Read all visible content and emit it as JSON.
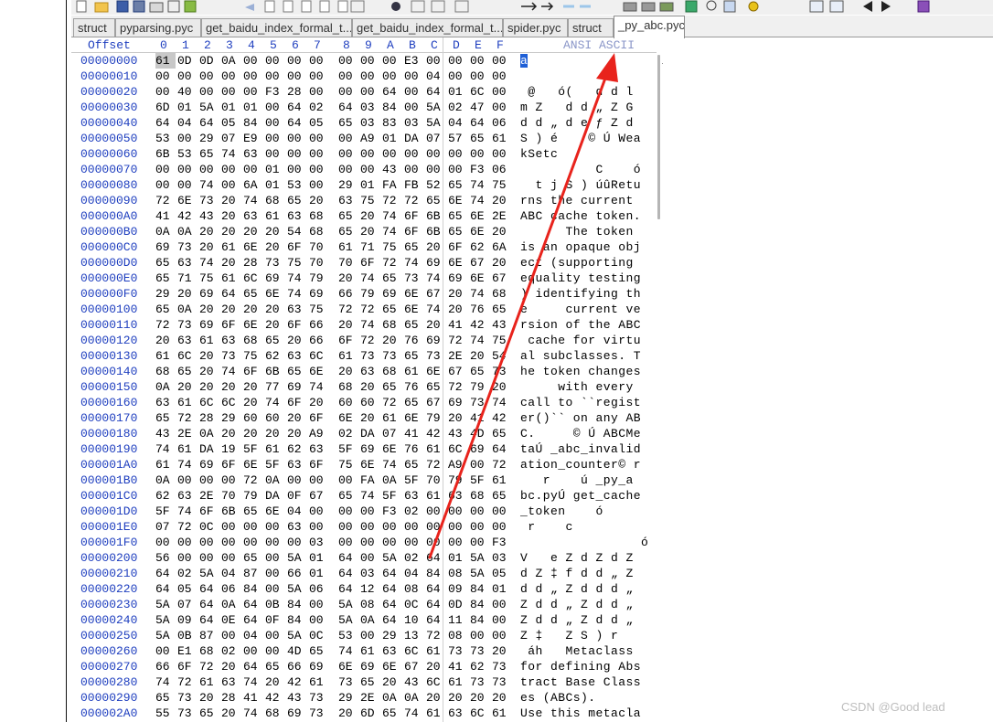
{
  "tabs": [
    {
      "label": "struct",
      "active": false
    },
    {
      "label": "pyparsing.pyc",
      "active": false
    },
    {
      "label": "get_baidu_index_formal_t...",
      "active": false
    },
    {
      "label": "get_baidu_index_formal_t...",
      "active": false
    },
    {
      "label": "spider.pyc",
      "active": false
    },
    {
      "label": "struct",
      "active": false
    },
    {
      "label": "_py_abc.pyc",
      "active": true
    }
  ],
  "header": {
    "offset_label": "Offset",
    "columns": [
      "0",
      "1",
      "2",
      "3",
      "4",
      "5",
      "6",
      "7",
      "8",
      "9",
      "A",
      "B",
      "C",
      "D",
      "E",
      "F"
    ],
    "ascii_label": "ANSI ASCII"
  },
  "rows": [
    {
      "offset": "00000000",
      "bytes": [
        "61",
        "0D",
        "0D",
        "0A",
        "00",
        "00",
        "00",
        "00",
        "00",
        "00",
        "00",
        "E3",
        "00",
        "00",
        "00",
        "00"
      ],
      "ascii": "a                 ã"
    },
    {
      "offset": "00000010",
      "bytes": [
        "00",
        "00",
        "00",
        "00",
        "00",
        "00",
        "00",
        "00",
        "00",
        "00",
        "00",
        "00",
        "04",
        "00",
        "00",
        "00"
      ],
      "ascii": ""
    },
    {
      "offset": "00000020",
      "bytes": [
        "00",
        "40",
        "00",
        "00",
        "00",
        "F3",
        "28",
        "00",
        "00",
        "00",
        "64",
        "00",
        "64",
        "01",
        "6C",
        "00"
      ],
      "ascii": " @   ó(   d d l"
    },
    {
      "offset": "00000030",
      "bytes": [
        "6D",
        "01",
        "5A",
        "01",
        "01",
        "00",
        "64",
        "02",
        "64",
        "03",
        "84",
        "00",
        "5A",
        "02",
        "47",
        "00"
      ],
      "ascii": "m Z   d d „ Z G"
    },
    {
      "offset": "00000040",
      "bytes": [
        "64",
        "04",
        "64",
        "05",
        "84",
        "00",
        "64",
        "05",
        "65",
        "03",
        "83",
        "03",
        "5A",
        "04",
        "64",
        "06"
      ],
      "ascii": "d d „ d e ƒ Z d"
    },
    {
      "offset": "00000050",
      "bytes": [
        "53",
        "00",
        "29",
        "07",
        "E9",
        "00",
        "00",
        "00",
        "00",
        "A9",
        "01",
        "DA",
        "07",
        "57",
        "65",
        "61"
      ],
      "ascii": "S ) é    © Ú Wea"
    },
    {
      "offset": "00000060",
      "bytes": [
        "6B",
        "53",
        "65",
        "74",
        "63",
        "00",
        "00",
        "00",
        "00",
        "00",
        "00",
        "00",
        "00",
        "00",
        "00",
        "00"
      ],
      "ascii": "kSetc"
    },
    {
      "offset": "00000070",
      "bytes": [
        "00",
        "00",
        "00",
        "00",
        "00",
        "01",
        "00",
        "00",
        "00",
        "00",
        "43",
        "00",
        "00",
        "00",
        "F3",
        "06",
        "00"
      ],
      "ascii": "          C    ó"
    },
    {
      "offset": "00000080",
      "bytes": [
        "00",
        "00",
        "74",
        "00",
        "6A",
        "01",
        "53",
        "00",
        "29",
        "01",
        "FA",
        "FB",
        "52",
        "65",
        "74",
        "75"
      ],
      "ascii": "  t j S ) úûRetu"
    },
    {
      "offset": "00000090",
      "bytes": [
        "72",
        "6E",
        "73",
        "20",
        "74",
        "68",
        "65",
        "20",
        "63",
        "75",
        "72",
        "72",
        "65",
        "6E",
        "74",
        "20"
      ],
      "ascii": "rns the current "
    },
    {
      "offset": "000000A0",
      "bytes": [
        "41",
        "42",
        "43",
        "20",
        "63",
        "61",
        "63",
        "68",
        "65",
        "20",
        "74",
        "6F",
        "6B",
        "65",
        "6E",
        "2E"
      ],
      "ascii": "ABC cache token."
    },
    {
      "offset": "000000B0",
      "bytes": [
        "0A",
        "0A",
        "20",
        "20",
        "20",
        "20",
        "54",
        "68",
        "65",
        "20",
        "74",
        "6F",
        "6B",
        "65",
        "6E",
        "20"
      ],
      "ascii": "      The token "
    },
    {
      "offset": "000000C0",
      "bytes": [
        "69",
        "73",
        "20",
        "61",
        "6E",
        "20",
        "6F",
        "70",
        "61",
        "71",
        "75",
        "65",
        "20",
        "6F",
        "62",
        "6A"
      ],
      "ascii": "is an opaque obj"
    },
    {
      "offset": "000000D0",
      "bytes": [
        "65",
        "63",
        "74",
        "20",
        "28",
        "73",
        "75",
        "70",
        "70",
        "6F",
        "72",
        "74",
        "69",
        "6E",
        "67",
        "20"
      ],
      "ascii": "ect (supporting "
    },
    {
      "offset": "000000E0",
      "bytes": [
        "65",
        "71",
        "75",
        "61",
        "6C",
        "69",
        "74",
        "79",
        "20",
        "74",
        "65",
        "73",
        "74",
        "69",
        "6E",
        "67"
      ],
      "ascii": "equality testing"
    },
    {
      "offset": "000000F0",
      "bytes": [
        "29",
        "20",
        "69",
        "64",
        "65",
        "6E",
        "74",
        "69",
        "66",
        "79",
        "69",
        "6E",
        "67",
        "20",
        "74",
        "68"
      ],
      "ascii": ") identifying th"
    },
    {
      "offset": "00000100",
      "bytes": [
        "65",
        "0A",
        "20",
        "20",
        "20",
        "20",
        "63",
        "75",
        "72",
        "72",
        "65",
        "6E",
        "74",
        "20",
        "76",
        "65"
      ],
      "ascii": "e     current ve"
    },
    {
      "offset": "00000110",
      "bytes": [
        "72",
        "73",
        "69",
        "6F",
        "6E",
        "20",
        "6F",
        "66",
        "20",
        "74",
        "68",
        "65",
        "20",
        "41",
        "42",
        "43"
      ],
      "ascii": "rsion of the ABC"
    },
    {
      "offset": "00000120",
      "bytes": [
        "20",
        "63",
        "61",
        "63",
        "68",
        "65",
        "20",
        "66",
        "6F",
        "72",
        "20",
        "76",
        "69",
        "72",
        "74",
        "75"
      ],
      "ascii": " cache for virtu"
    },
    {
      "offset": "00000130",
      "bytes": [
        "61",
        "6C",
        "20",
        "73",
        "75",
        "62",
        "63",
        "6C",
        "61",
        "73",
        "73",
        "65",
        "73",
        "2E",
        "20",
        "54"
      ],
      "ascii": "al subclasses. T"
    },
    {
      "offset": "00000140",
      "bytes": [
        "68",
        "65",
        "20",
        "74",
        "6F",
        "6B",
        "65",
        "6E",
        "20",
        "63",
        "68",
        "61",
        "6E",
        "67",
        "65",
        "73"
      ],
      "ascii": "he token changes"
    },
    {
      "offset": "00000150",
      "bytes": [
        "0A",
        "20",
        "20",
        "20",
        "20",
        "77",
        "69",
        "74",
        "68",
        "20",
        "65",
        "76",
        "65",
        "72",
        "79",
        "20"
      ],
      "ascii": "     with every "
    },
    {
      "offset": "00000160",
      "bytes": [
        "63",
        "61",
        "6C",
        "6C",
        "20",
        "74",
        "6F",
        "20",
        "60",
        "60",
        "72",
        "65",
        "67",
        "69",
        "73",
        "74"
      ],
      "ascii": "call to ``regist"
    },
    {
      "offset": "00000170",
      "bytes": [
        "65",
        "72",
        "28",
        "29",
        "60",
        "60",
        "20",
        "6F",
        "6E",
        "20",
        "61",
        "6E",
        "79",
        "20",
        "41",
        "42"
      ],
      "ascii": "er()`` on any AB"
    },
    {
      "offset": "00000180",
      "bytes": [
        "43",
        "2E",
        "0A",
        "20",
        "20",
        "20",
        "20",
        "A9",
        "02",
        "DA",
        "07",
        "41",
        "42",
        "43",
        "4D",
        "65"
      ],
      "ascii": "C.     © Ú ABCMe"
    },
    {
      "offset": "00000190",
      "bytes": [
        "74",
        "61",
        "DA",
        "19",
        "5F",
        "61",
        "62",
        "63",
        "5F",
        "69",
        "6E",
        "76",
        "61",
        "6C",
        "69",
        "64"
      ],
      "ascii": "taÚ _abc_invalid"
    },
    {
      "offset": "000001A0",
      "bytes": [
        "61",
        "74",
        "69",
        "6F",
        "6E",
        "5F",
        "63",
        "6F",
        "75",
        "6E",
        "74",
        "65",
        "72",
        "A9",
        "00",
        "72"
      ],
      "ascii": "ation_counter© r"
    },
    {
      "offset": "000001B0",
      "bytes": [
        "0A",
        "00",
        "00",
        "00",
        "72",
        "0A",
        "00",
        "00",
        "00",
        "FA",
        "0A",
        "5F",
        "70",
        "79",
        "5F",
        "61"
      ],
      "ascii": "   r    ú _py_a"
    },
    {
      "offset": "000001C0",
      "bytes": [
        "62",
        "63",
        "2E",
        "70",
        "79",
        "DA",
        "0F",
        "67",
        "65",
        "74",
        "5F",
        "63",
        "61",
        "63",
        "68",
        "65"
      ],
      "ascii": "bc.pyÚ get_cache"
    },
    {
      "offset": "000001D0",
      "bytes": [
        "5F",
        "74",
        "6F",
        "6B",
        "65",
        "6E",
        "04",
        "00",
        "00",
        "00",
        "F3",
        "02",
        "00",
        "00",
        "00",
        "00"
      ],
      "ascii": "_token    ó"
    },
    {
      "offset": "000001E0",
      "bytes": [
        "07",
        "72",
        "0C",
        "00",
        "00",
        "00",
        "63",
        "00",
        "00",
        "00",
        "00",
        "00",
        "00",
        "00",
        "00",
        "00"
      ],
      "ascii": " r    c"
    },
    {
      "offset": "000001F0",
      "bytes": [
        "00",
        "00",
        "00",
        "00",
        "00",
        "00",
        "00",
        "03",
        "00",
        "00",
        "00",
        "00",
        "00",
        "00",
        "00",
        "F3"
      ],
      "ascii": "                ó"
    },
    {
      "offset": "00000200",
      "bytes": [
        "56",
        "00",
        "00",
        "00",
        "65",
        "00",
        "5A",
        "01",
        "64",
        "00",
        "5A",
        "02",
        "64",
        "01",
        "5A",
        "03"
      ],
      "ascii": "V   e Z d Z d Z"
    },
    {
      "offset": "00000210",
      "bytes": [
        "64",
        "02",
        "5A",
        "04",
        "87",
        "00",
        "66",
        "01",
        "64",
        "03",
        "64",
        "04",
        "84",
        "08",
        "5A",
        "05"
      ],
      "ascii": "d Z ‡ f d d „ Z"
    },
    {
      "offset": "00000220",
      "bytes": [
        "64",
        "05",
        "64",
        "06",
        "84",
        "00",
        "5A",
        "06",
        "64",
        "12",
        "64",
        "08",
        "64",
        "09",
        "84",
        "01"
      ],
      "ascii": "d d „ Z d d d „"
    },
    {
      "offset": "00000230",
      "bytes": [
        "5A",
        "07",
        "64",
        "0A",
        "64",
        "0B",
        "84",
        "00",
        "5A",
        "08",
        "64",
        "0C",
        "64",
        "0D",
        "84",
        "00"
      ],
      "ascii": "Z d d „ Z d d „"
    },
    {
      "offset": "00000240",
      "bytes": [
        "5A",
        "09",
        "64",
        "0E",
        "64",
        "0F",
        "84",
        "00",
        "5A",
        "0A",
        "64",
        "10",
        "64",
        "11",
        "84",
        "00"
      ],
      "ascii": "Z d d „ Z d d „"
    },
    {
      "offset": "00000250",
      "bytes": [
        "5A",
        "0B",
        "87",
        "00",
        "04",
        "00",
        "5A",
        "0C",
        "53",
        "00",
        "29",
        "13",
        "72",
        "08",
        "00",
        "00"
      ],
      "ascii": "Z ‡   Z S ) r"
    },
    {
      "offset": "00000260",
      "bytes": [
        "00",
        "E1",
        "68",
        "02",
        "00",
        "00",
        "4D",
        "65",
        "74",
        "61",
        "63",
        "6C",
        "61",
        "73",
        "73",
        "20"
      ],
      "ascii": " áh   Metaclass "
    },
    {
      "offset": "00000270",
      "bytes": [
        "66",
        "6F",
        "72",
        "20",
        "64",
        "65",
        "66",
        "69",
        "6E",
        "69",
        "6E",
        "67",
        "20",
        "41",
        "62",
        "73"
      ],
      "ascii": "for defining Abs"
    },
    {
      "offset": "00000280",
      "bytes": [
        "74",
        "72",
        "61",
        "63",
        "74",
        "20",
        "42",
        "61",
        "73",
        "65",
        "20",
        "43",
        "6C",
        "61",
        "73",
        "73"
      ],
      "ascii": "tract Base Class"
    },
    {
      "offset": "00000290",
      "bytes": [
        "65",
        "73",
        "20",
        "28",
        "41",
        "42",
        "43",
        "73",
        "29",
        "2E",
        "0A",
        "0A",
        "20",
        "20",
        "20",
        "20"
      ],
      "ascii": "es (ABCs)."
    },
    {
      "offset": "000002A0",
      "bytes": [
        "55",
        "73",
        "65",
        "20",
        "74",
        "68",
        "69",
        "73",
        "20",
        "6D",
        "65",
        "74",
        "61",
        "63",
        "6C",
        "61"
      ],
      "ascii": "Use this metacla"
    }
  ],
  "watermark": "CSDN @Good lead",
  "colors": {
    "annotation_arrow": "#e8231c",
    "offset_text": "#1f3fbf",
    "selection": "#1e5fd6"
  }
}
